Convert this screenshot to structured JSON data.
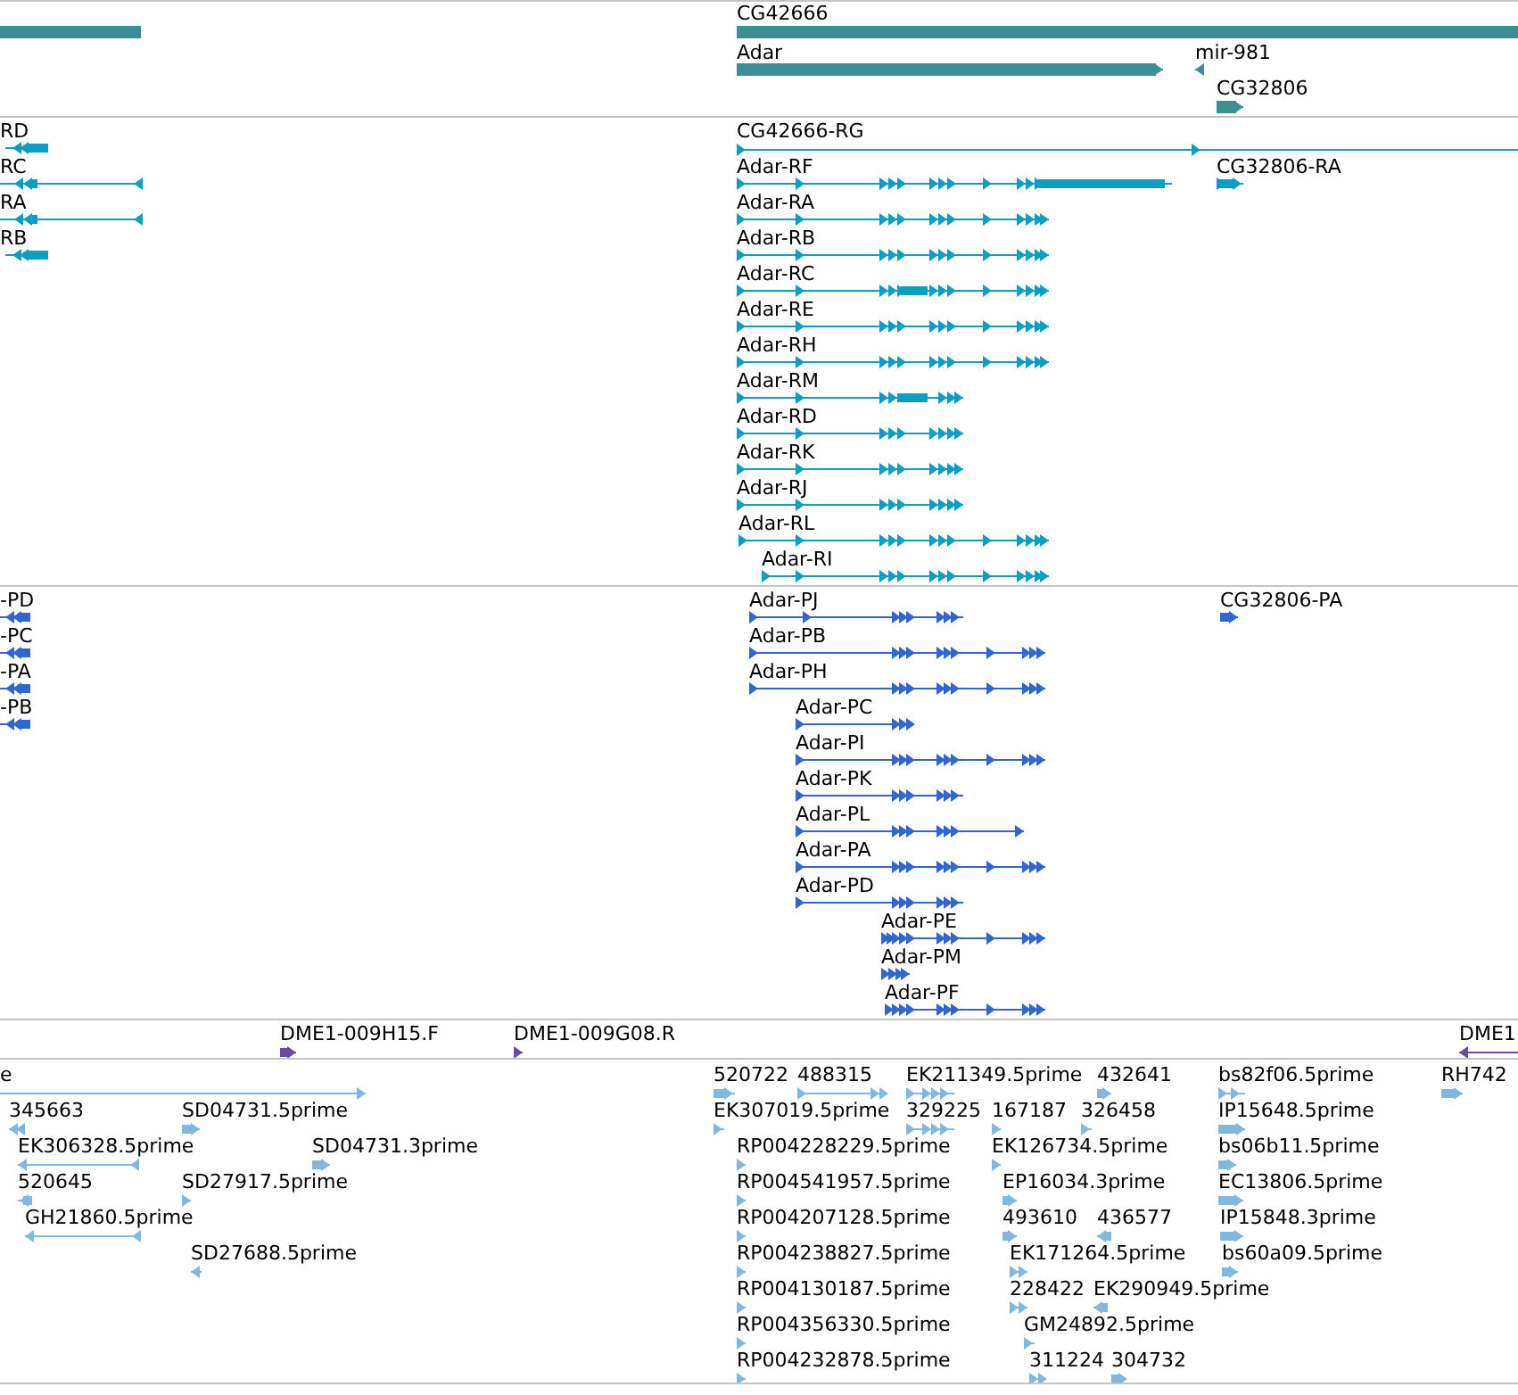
{
  "tracks": [
    {
      "color": "#3a8e94",
      "features": [
        {
          "kind": "gene"
        },
        {
          "kind": "gene",
          "label": "CG42666"
        },
        {
          "kind": "gene",
          "label": "Adar",
          "reverse": false
        },
        {
          "kind": "gene",
          "label": "mir-981",
          "reverse": true
        },
        {
          "kind": "gene",
          "label": "CG32806",
          "reverse": false
        }
      ]
    },
    {
      "color": "#0a9ec4",
      "features": [
        {
          "label": "RD",
          "reverse": true
        },
        {
          "label": "RC",
          "reverse": true
        },
        {
          "label": "RA",
          "reverse": true
        },
        {
          "label": "RB",
          "reverse": true
        },
        {
          "label": "CG42666-RG",
          "reverse": false
        },
        {
          "label": "Adar-RF",
          "reverse": false
        },
        {
          "label": "Adar-RA",
          "reverse": false
        },
        {
          "label": "Adar-RB",
          "reverse": false
        },
        {
          "label": "Adar-RC",
          "reverse": false
        },
        {
          "label": "Adar-RE",
          "reverse": false
        },
        {
          "label": "Adar-RH",
          "reverse": false
        },
        {
          "label": "Adar-RM",
          "reverse": false
        },
        {
          "label": "Adar-RD",
          "reverse": false
        },
        {
          "label": "Adar-RK",
          "reverse": false
        },
        {
          "label": "Adar-RJ",
          "reverse": false
        },
        {
          "label": "Adar-RL",
          "reverse": false
        },
        {
          "label": "Adar-RI",
          "reverse": false
        },
        {
          "label": "CG32806-RA",
          "reverse": false
        }
      ]
    },
    {
      "color": "#3066d0",
      "features": [
        {
          "label": "-PD",
          "reverse": true
        },
        {
          "label": "-PC",
          "reverse": true
        },
        {
          "label": "-PA",
          "reverse": true
        },
        {
          "label": "-PB",
          "reverse": true
        },
        {
          "label": "Adar-PJ",
          "reverse": false
        },
        {
          "label": "Adar-PB",
          "reverse": false
        },
        {
          "label": "Adar-PH",
          "reverse": false
        },
        {
          "label": "Adar-PC",
          "reverse": false
        },
        {
          "label": "Adar-PI",
          "reverse": false
        },
        {
          "label": "Adar-PK",
          "reverse": false
        },
        {
          "label": "Adar-PL",
          "reverse": false
        },
        {
          "label": "Adar-PA",
          "reverse": false
        },
        {
          "label": "Adar-PD",
          "reverse": false
        },
        {
          "label": "Adar-PE",
          "reverse": false
        },
        {
          "label": "Adar-PM",
          "reverse": false
        },
        {
          "label": "Adar-PF",
          "reverse": false
        },
        {
          "label": "CG32806-PA",
          "reverse": false
        }
      ]
    },
    {
      "color": "#6a4ca8",
      "features": [
        {
          "label": "DME1-009H15.F",
          "reverse": false
        },
        {
          "label": "DME1-009G08.R",
          "reverse": false
        },
        {
          "label": "DME1",
          "reverse": true
        }
      ]
    },
    {
      "color": "#80b8e0",
      "features": [
        {
          "label": "e",
          "reverse": false
        },
        {
          "label": "345663",
          "reverse": true
        },
        {
          "label": "SD04731.5prime",
          "reverse": false
        },
        {
          "label": "EK306328.5prime",
          "reverse": true
        },
        {
          "label": "SD04731.3prime",
          "reverse": false
        },
        {
          "label": "520645",
          "reverse": true
        },
        {
          "label": "SD27917.5prime",
          "reverse": false
        },
        {
          "label": "GH21860.5prime",
          "reverse": true
        },
        {
          "label": "SD27688.5prime",
          "reverse": true
        },
        {
          "label": "520722",
          "reverse": false
        },
        {
          "label": "488315",
          "reverse": false
        },
        {
          "label": "EK211349.5prime",
          "reverse": false
        },
        {
          "label": "432641",
          "reverse": false
        },
        {
          "label": "bs82f06.5prime",
          "reverse": false
        },
        {
          "label": "RH742",
          "reverse": false
        },
        {
          "label": "EK307019.5prime",
          "reverse": false
        },
        {
          "label": "329225",
          "reverse": false
        },
        {
          "label": "167187",
          "reverse": false
        },
        {
          "label": "326458",
          "reverse": false
        },
        {
          "label": "IP15648.5prime",
          "reverse": false
        },
        {
          "label": "RP004228229.5prime",
          "reverse": false
        },
        {
          "label": "EK126734.5prime",
          "reverse": false
        },
        {
          "label": "bs06b11.5prime",
          "reverse": false
        },
        {
          "label": "RP004541957.5prime",
          "reverse": false
        },
        {
          "label": "EP16034.3prime",
          "reverse": false
        },
        {
          "label": "EC13806.5prime",
          "reverse": false
        },
        {
          "label": "RP004207128.5prime",
          "reverse": false
        },
        {
          "label": "493610",
          "reverse": false
        },
        {
          "label": "436577",
          "reverse": true
        },
        {
          "label": "IP15848.3prime",
          "reverse": false
        },
        {
          "label": "RP004238827.5prime",
          "reverse": false
        },
        {
          "label": "EK171264.5prime",
          "reverse": false
        },
        {
          "label": "bs60a09.5prime",
          "reverse": false
        },
        {
          "label": "RP004130187.5prime",
          "reverse": false
        },
        {
          "label": "228422",
          "reverse": false
        },
        {
          "label": "EK290949.5prime",
          "reverse": true
        },
        {
          "label": "RP004356330.5prime",
          "reverse": false
        },
        {
          "label": "GM24892.5prime",
          "reverse": false
        },
        {
          "label": "RP004232878.5prime",
          "reverse": false
        },
        {
          "label": "311224",
          "reverse": false
        },
        {
          "label": "304732",
          "reverse": false
        }
      ]
    }
  ]
}
